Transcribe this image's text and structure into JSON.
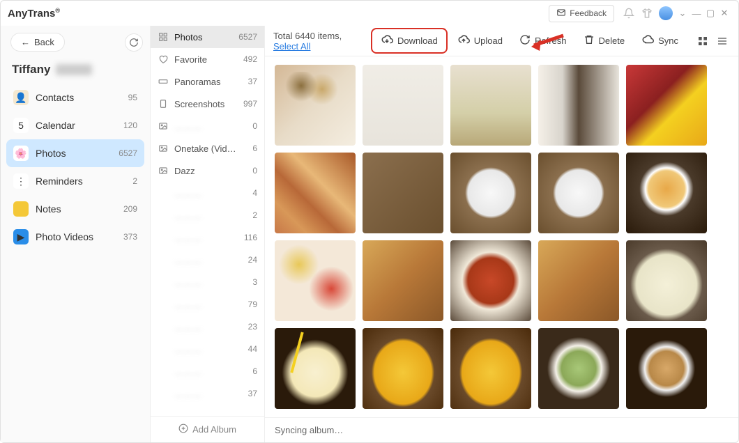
{
  "app_title": "AnyTrans",
  "titlebar": {
    "feedback": "Feedback"
  },
  "sidebar": {
    "back": "Back",
    "user_name": "Tiffany",
    "items": [
      {
        "label": "Contacts",
        "count": "95",
        "icon_bg": "#f4e8d0",
        "icon": "👤"
      },
      {
        "label": "Calendar",
        "count": "120",
        "icon_bg": "#fff",
        "icon": "5"
      },
      {
        "label": "Photos",
        "count": "6527",
        "icon_bg": "#fff",
        "icon": "🌸",
        "active": true
      },
      {
        "label": "Reminders",
        "count": "2",
        "icon_bg": "#fff",
        "icon": "⋮"
      },
      {
        "label": "Notes",
        "count": "209",
        "icon_bg": "#f4c838",
        "icon": ""
      },
      {
        "label": "Photo Videos",
        "count": "373",
        "icon_bg": "#2a8de8",
        "icon": "▶"
      }
    ]
  },
  "albums": {
    "items": [
      {
        "label": "Photos",
        "count": "6527",
        "icon": "grid",
        "active": true
      },
      {
        "label": "Favorite",
        "count": "492",
        "icon": "heart"
      },
      {
        "label": "Panoramas",
        "count": "37",
        "icon": "pano"
      },
      {
        "label": "Screenshots",
        "count": "997",
        "icon": "screen"
      },
      {
        "label": "",
        "count": "0",
        "icon": "image",
        "blur": true
      },
      {
        "label": "Onetake (Vid…",
        "count": "6",
        "icon": "image"
      },
      {
        "label": "Dazz",
        "count": "0",
        "icon": "image"
      },
      {
        "label": "",
        "count": "4",
        "icon": "",
        "blur": true
      },
      {
        "label": "",
        "count": "2",
        "icon": "",
        "blur": true
      },
      {
        "label": "",
        "count": "116",
        "icon": "",
        "blur": true
      },
      {
        "label": "",
        "count": "24",
        "icon": "",
        "blur": true
      },
      {
        "label": "",
        "count": "3",
        "icon": "",
        "blur": true
      },
      {
        "label": "",
        "count": "79",
        "icon": "",
        "blur": true
      },
      {
        "label": "",
        "count": "23",
        "icon": "",
        "blur": true
      },
      {
        "label": "",
        "count": "44",
        "icon": "",
        "blur": true
      },
      {
        "label": "",
        "count": "6",
        "icon": "",
        "blur": true
      },
      {
        "label": "",
        "count": "37",
        "icon": "",
        "blur": true
      }
    ],
    "add": "Add Album"
  },
  "toolbar": {
    "total_prefix": "Total 6440 items, ",
    "select_all": "Select All",
    "download": "Download",
    "upload": "Upload",
    "refresh": "Refresh",
    "delete": "Delete",
    "sync": "Sync"
  },
  "status": "Syncing album…",
  "thumbnails": [
    [
      "t-flowers",
      "t-cafe",
      "t-grass",
      "t-boba",
      "t-lantern"
    ],
    [
      "t-mural",
      "t-table",
      "t-plate",
      "t-plate",
      "t-dish"
    ],
    [
      "t-food1",
      "t-food2",
      "t-food3",
      "t-food2",
      "t-drink"
    ],
    [
      "t-lemon",
      "t-egg",
      "t-egg",
      "t-salad",
      "t-pie"
    ]
  ]
}
